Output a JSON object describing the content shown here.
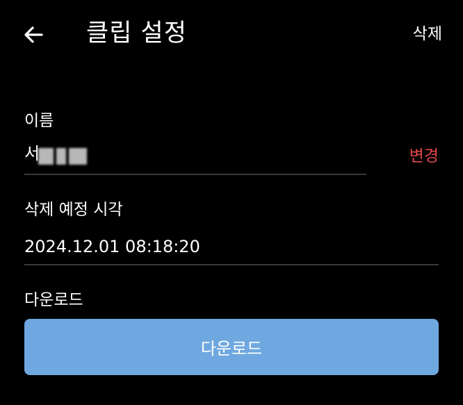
{
  "header": {
    "back_icon": "arrow-left-icon",
    "title": "클립 설정",
    "delete_label": "삭제"
  },
  "name_field": {
    "label": "이름",
    "value": "서",
    "change_label": "변경",
    "change_color": "#e5484d"
  },
  "schedule_field": {
    "label": "삭제 예정 시각",
    "value": "2024.12.01 08:18:20"
  },
  "download_section": {
    "label": "다운로드",
    "button_label": "다운로드",
    "button_color": "#6fa8e0"
  }
}
